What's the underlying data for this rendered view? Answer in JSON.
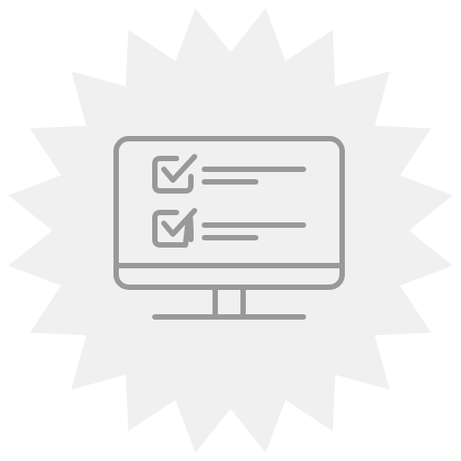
{
  "badge": {
    "icon": "starburst-badge-icon",
    "fill": "#f0f0f0"
  },
  "monitor": {
    "icon": "monitor-checklist-icon",
    "stroke": "#999999",
    "checklist": {
      "items": [
        {
          "icon": "checked-checkbox-icon",
          "checked": true
        },
        {
          "icon": "checked-checkbox-icon",
          "checked": true
        }
      ]
    }
  }
}
